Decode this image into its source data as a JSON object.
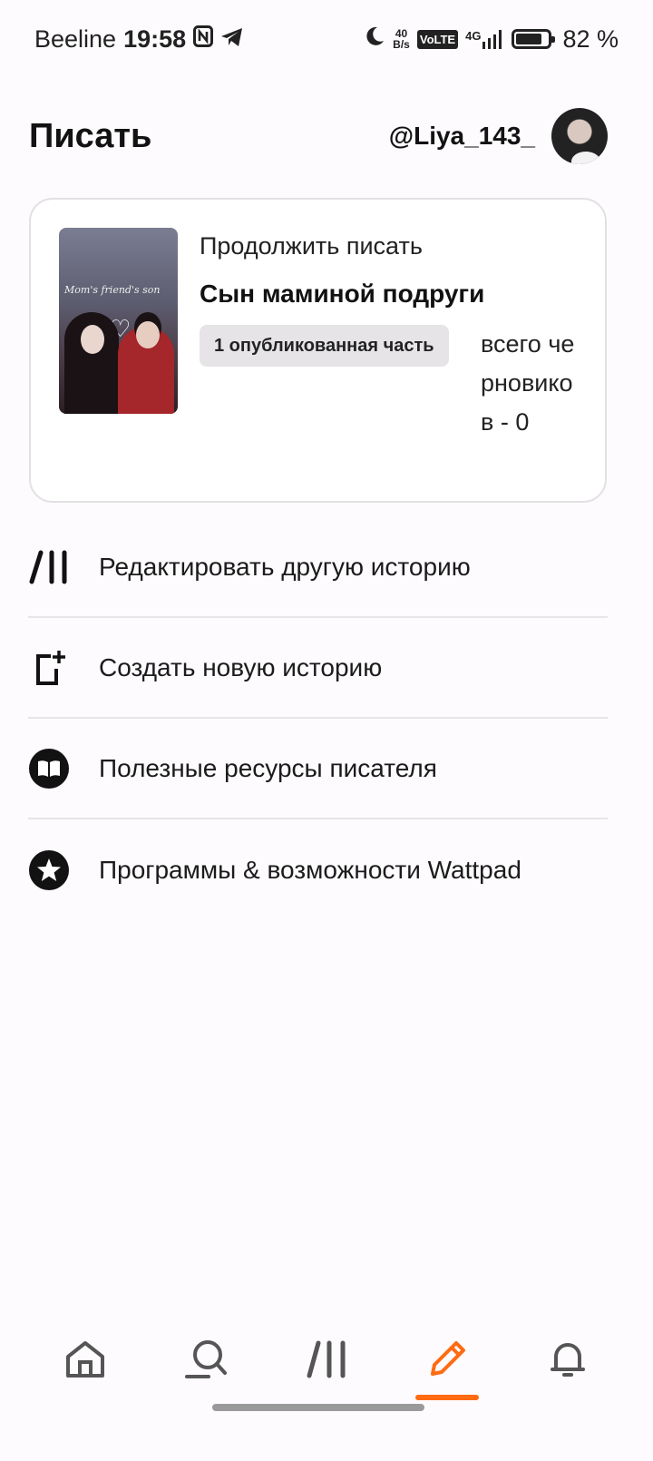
{
  "status_bar": {
    "carrier": "Beeline",
    "time": "19:58",
    "net_speed_value": "40",
    "net_speed_unit": "B/s",
    "volte": "VoLTE",
    "network": "4G",
    "battery_percent": 82,
    "battery_label": "82 %"
  },
  "header": {
    "title": "Писать",
    "username": "@Liya_143_"
  },
  "continue_card": {
    "label": "Продолжить писать",
    "story_title": "Сын маминой подруги",
    "cover_text": "Mom's friend's son",
    "published_badge": "1 опубликованная часть",
    "drafts_text": "всего черновиков - 0"
  },
  "menu": {
    "items": [
      {
        "label": "Редактировать другую историю",
        "icon": "library-icon"
      },
      {
        "label": "Создать новую историю",
        "icon": "new-story-icon"
      },
      {
        "label": "Полезные ресурсы писателя",
        "icon": "book-icon"
      },
      {
        "label": "Программы & возможности Wattpad",
        "icon": "star-icon"
      }
    ]
  },
  "bottom_nav": {
    "items": [
      "home-icon",
      "search-icon",
      "library-icon",
      "write-icon",
      "bell-icon"
    ],
    "active": "write-icon",
    "accent_color": "#ff6b12"
  }
}
